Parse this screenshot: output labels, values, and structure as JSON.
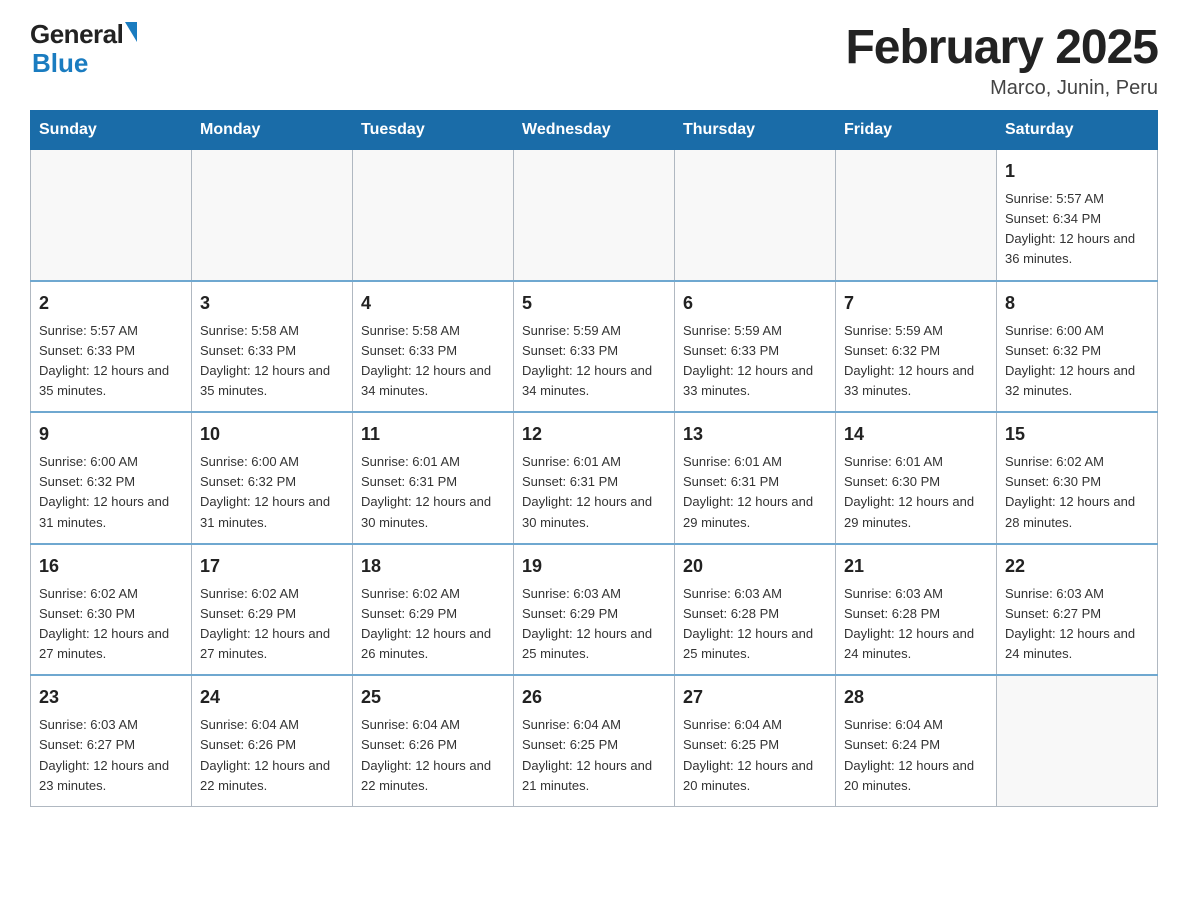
{
  "header": {
    "logo_general": "General",
    "logo_blue": "Blue",
    "month_year": "February 2025",
    "location": "Marco, Junin, Peru"
  },
  "days_of_week": [
    "Sunday",
    "Monday",
    "Tuesday",
    "Wednesday",
    "Thursday",
    "Friday",
    "Saturday"
  ],
  "weeks": [
    [
      {
        "day": "",
        "info": ""
      },
      {
        "day": "",
        "info": ""
      },
      {
        "day": "",
        "info": ""
      },
      {
        "day": "",
        "info": ""
      },
      {
        "day": "",
        "info": ""
      },
      {
        "day": "",
        "info": ""
      },
      {
        "day": "1",
        "info": "Sunrise: 5:57 AM\nSunset: 6:34 PM\nDaylight: 12 hours and 36 minutes."
      }
    ],
    [
      {
        "day": "2",
        "info": "Sunrise: 5:57 AM\nSunset: 6:33 PM\nDaylight: 12 hours and 35 minutes."
      },
      {
        "day": "3",
        "info": "Sunrise: 5:58 AM\nSunset: 6:33 PM\nDaylight: 12 hours and 35 minutes."
      },
      {
        "day": "4",
        "info": "Sunrise: 5:58 AM\nSunset: 6:33 PM\nDaylight: 12 hours and 34 minutes."
      },
      {
        "day": "5",
        "info": "Sunrise: 5:59 AM\nSunset: 6:33 PM\nDaylight: 12 hours and 34 minutes."
      },
      {
        "day": "6",
        "info": "Sunrise: 5:59 AM\nSunset: 6:33 PM\nDaylight: 12 hours and 33 minutes."
      },
      {
        "day": "7",
        "info": "Sunrise: 5:59 AM\nSunset: 6:32 PM\nDaylight: 12 hours and 33 minutes."
      },
      {
        "day": "8",
        "info": "Sunrise: 6:00 AM\nSunset: 6:32 PM\nDaylight: 12 hours and 32 minutes."
      }
    ],
    [
      {
        "day": "9",
        "info": "Sunrise: 6:00 AM\nSunset: 6:32 PM\nDaylight: 12 hours and 31 minutes."
      },
      {
        "day": "10",
        "info": "Sunrise: 6:00 AM\nSunset: 6:32 PM\nDaylight: 12 hours and 31 minutes."
      },
      {
        "day": "11",
        "info": "Sunrise: 6:01 AM\nSunset: 6:31 PM\nDaylight: 12 hours and 30 minutes."
      },
      {
        "day": "12",
        "info": "Sunrise: 6:01 AM\nSunset: 6:31 PM\nDaylight: 12 hours and 30 minutes."
      },
      {
        "day": "13",
        "info": "Sunrise: 6:01 AM\nSunset: 6:31 PM\nDaylight: 12 hours and 29 minutes."
      },
      {
        "day": "14",
        "info": "Sunrise: 6:01 AM\nSunset: 6:30 PM\nDaylight: 12 hours and 29 minutes."
      },
      {
        "day": "15",
        "info": "Sunrise: 6:02 AM\nSunset: 6:30 PM\nDaylight: 12 hours and 28 minutes."
      }
    ],
    [
      {
        "day": "16",
        "info": "Sunrise: 6:02 AM\nSunset: 6:30 PM\nDaylight: 12 hours and 27 minutes."
      },
      {
        "day": "17",
        "info": "Sunrise: 6:02 AM\nSunset: 6:29 PM\nDaylight: 12 hours and 27 minutes."
      },
      {
        "day": "18",
        "info": "Sunrise: 6:02 AM\nSunset: 6:29 PM\nDaylight: 12 hours and 26 minutes."
      },
      {
        "day": "19",
        "info": "Sunrise: 6:03 AM\nSunset: 6:29 PM\nDaylight: 12 hours and 25 minutes."
      },
      {
        "day": "20",
        "info": "Sunrise: 6:03 AM\nSunset: 6:28 PM\nDaylight: 12 hours and 25 minutes."
      },
      {
        "day": "21",
        "info": "Sunrise: 6:03 AM\nSunset: 6:28 PM\nDaylight: 12 hours and 24 minutes."
      },
      {
        "day": "22",
        "info": "Sunrise: 6:03 AM\nSunset: 6:27 PM\nDaylight: 12 hours and 24 minutes."
      }
    ],
    [
      {
        "day": "23",
        "info": "Sunrise: 6:03 AM\nSunset: 6:27 PM\nDaylight: 12 hours and 23 minutes."
      },
      {
        "day": "24",
        "info": "Sunrise: 6:04 AM\nSunset: 6:26 PM\nDaylight: 12 hours and 22 minutes."
      },
      {
        "day": "25",
        "info": "Sunrise: 6:04 AM\nSunset: 6:26 PM\nDaylight: 12 hours and 22 minutes."
      },
      {
        "day": "26",
        "info": "Sunrise: 6:04 AM\nSunset: 6:25 PM\nDaylight: 12 hours and 21 minutes."
      },
      {
        "day": "27",
        "info": "Sunrise: 6:04 AM\nSunset: 6:25 PM\nDaylight: 12 hours and 20 minutes."
      },
      {
        "day": "28",
        "info": "Sunrise: 6:04 AM\nSunset: 6:24 PM\nDaylight: 12 hours and 20 minutes."
      },
      {
        "day": "",
        "info": ""
      }
    ]
  ]
}
